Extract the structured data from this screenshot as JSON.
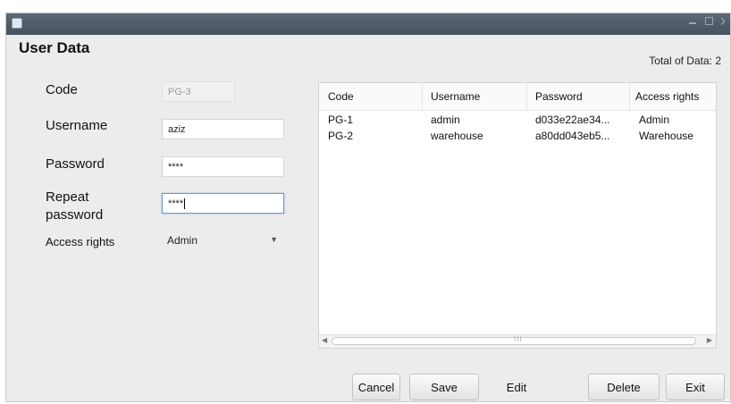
{
  "window": {
    "title": ""
  },
  "form": {
    "heading": "User Data",
    "code_label": "Code",
    "code_value": "PG-3",
    "username_label": "Username",
    "username_value": "aziz",
    "password_label": "Password",
    "password_value": "****",
    "repeat_label_line1": "Repeat",
    "repeat_label_line2": "password",
    "repeat_value": "****",
    "access_label": "Access rights",
    "access_value": "Admin"
  },
  "total_label": "Total of Data: 2",
  "table": {
    "columns": [
      "Code",
      "Username",
      "Password",
      "Access rights"
    ],
    "rows": [
      [
        "PG-1",
        "admin",
        "d033e22ae34...",
        "Admin"
      ],
      [
        "PG-2",
        "warehouse",
        "a80dd043eb5...",
        "Warehouse"
      ]
    ],
    "scroll_grip": "III"
  },
  "buttons": {
    "cancel": "Cancel",
    "save": "Save",
    "edit": "Edit",
    "delete": "Delete",
    "exit": "Exit"
  },
  "icons": {
    "app": "window-icon",
    "minimize": "minimize-icon",
    "maximize": "maximize-icon",
    "close": "close-icon",
    "dropdown": "chevron-down-icon",
    "scroll_left": "scroll-left-icon",
    "scroll_right": "scroll-right-icon"
  },
  "colors": {
    "titlebar": "#4f5b67",
    "window_bg": "#ececec",
    "focus_border": "#6d9ad0"
  }
}
